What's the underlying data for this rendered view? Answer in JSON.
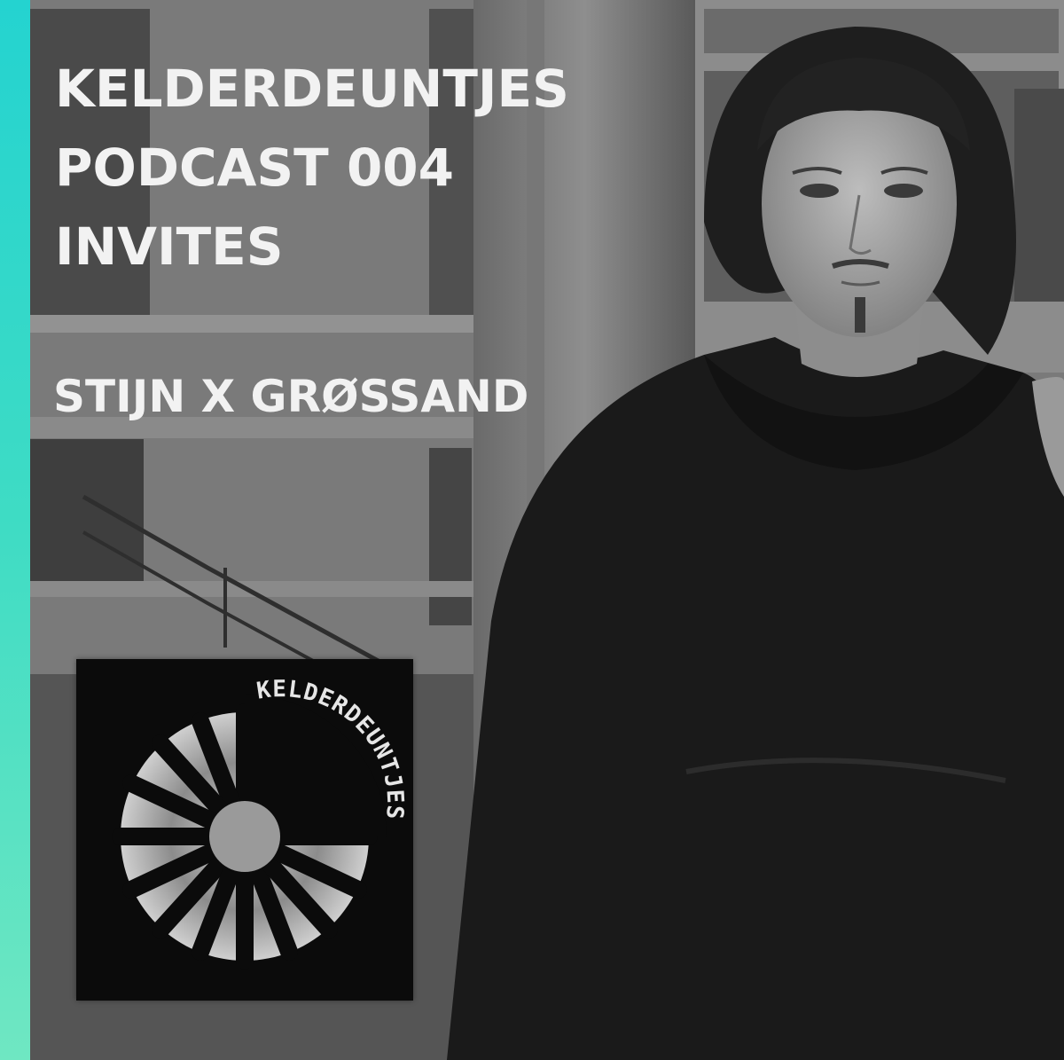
{
  "cover": {
    "title_lines": [
      "KELDERDEUNTJES",
      "PODCAST 004",
      "INVITES"
    ],
    "guest_line": "STIJN X GRØSSAND"
  },
  "logo": {
    "wordmark": "KELDERDEUNTJES"
  },
  "colors": {
    "accent_stripe_top": "#24d3d0",
    "accent_stripe_bottom": "#6fe7c2",
    "text": "#f2f2f2",
    "logo_bg": "#0b0b0b"
  }
}
